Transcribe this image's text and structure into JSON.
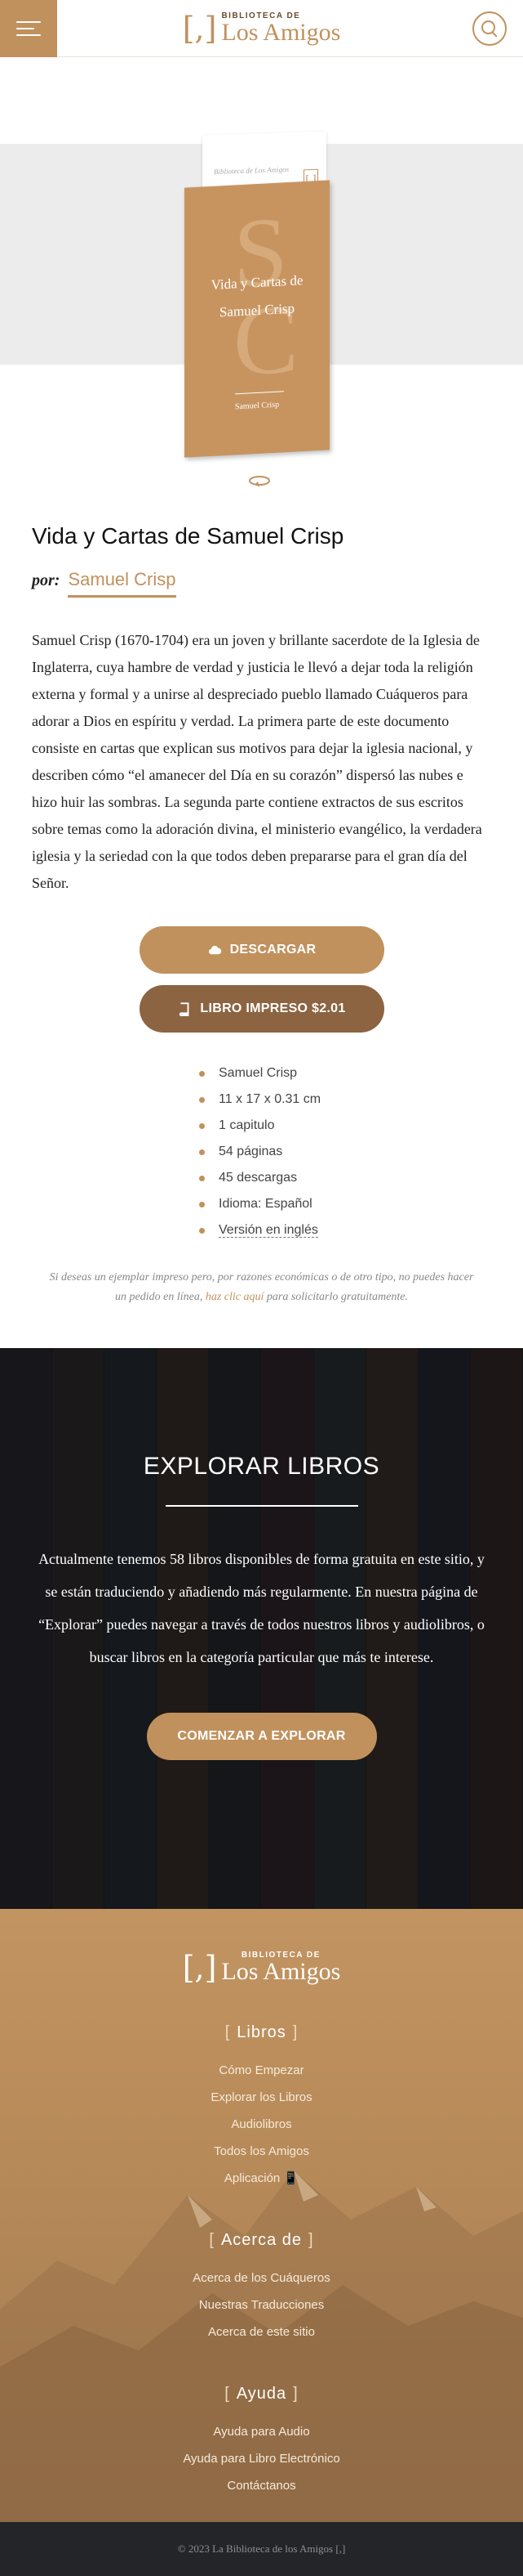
{
  "header": {
    "logo_small": "BIBLIOTECA DE",
    "logo_big": "Los Amigos",
    "logo_bracket": "[,]",
    "menu_icon": "hamburger-icon",
    "search_icon": "search-icon"
  },
  "cover": {
    "page_text": "Biblioteca de Los Amigos",
    "page_mark": "[,]",
    "letters": "S C",
    "title_line1": "Vida y Cartas de",
    "title_line2": "Samuel Crisp",
    "author": "Samuel Crisp",
    "flip_icon": "flip-icon",
    "cover_color": "#c79460"
  },
  "book": {
    "title": "Vida y Cartas de Samuel Crisp",
    "by_label": "por:",
    "author": "Samuel Crisp",
    "description": "Samuel Crisp (1670-1704) era un joven y brillante sacerdote de la Iglesia de Inglaterra, cuya hambre de verdad y justicia le llevó a dejar toda la religión externa y formal y a unirse al despreciado pueblo llamado Cuáqueros para adorar a Dios en espíritu y verdad. La primera parte de este documento consiste en cartas que explican sus motivos para dejar la iglesia nacional, y describen cómo “el amanecer del Día en su corazón” dispersó las nubes e hizo huir las sombras. La segunda parte contiene extractos de sus escritos sobre temas como la adoración divina, el ministerio evangélico, la verdadera iglesia y la seriedad con la que todos deben prepararse para el gran día del Señor."
  },
  "actions": {
    "download_label": "Descargar",
    "download_icon": "cloud-icon",
    "print_label": "Libro Impreso $2.01",
    "print_icon": "book-icon"
  },
  "facts": [
    "Samuel Crisp",
    "11 x 17 x 0.31 cm",
    "1 capitulo",
    "54 páginas",
    "45 descargas",
    "Idioma: Español"
  ],
  "english_link": "Versión en inglés",
  "note": {
    "before": "Si deseas un ejemplar impreso pero, por razones económicas o de otro tipo, no puedes hacer un pedido en línea,",
    "link": "haz clic aquí",
    "after": "para solicitarlo gratuitamente."
  },
  "explore": {
    "title": "EXPLORAR LIBROS",
    "text": "Actualmente tenemos 58 libros disponibles de forma gratuita en este sitio, y se están traduciendo y añadiendo más regularmente. En nuestra página de “Explorar” puedes navegar a través de todos nuestros libros y audiolibros, o buscar libros en la categoría particular que más te interese.",
    "button": "Comenzar a Explorar"
  },
  "footer": {
    "sections": [
      {
        "heading": "Libros",
        "links": [
          "Cómo Empezar",
          "Explorar los Libros",
          "Audiolibros",
          "Todos los Amigos",
          "Aplicación 📱"
        ]
      },
      {
        "heading": "Acerca de",
        "links": [
          "Acerca de los Cuáqueros",
          "Nuestras Traducciones",
          "Acerca de este sitio"
        ]
      },
      {
        "heading": "Ayuda",
        "links": [
          "Ayuda para Audio",
          "Ayuda para Libro Electrónico",
          "Contáctanos"
        ]
      }
    ],
    "copyright": "© 2023 La Biblioteca de los Amigos [,]"
  },
  "colors": {
    "accent": "#c1915d",
    "accent_dark": "#8c6441",
    "explore_bg": "#151518",
    "copyright_bg": "#232529"
  }
}
